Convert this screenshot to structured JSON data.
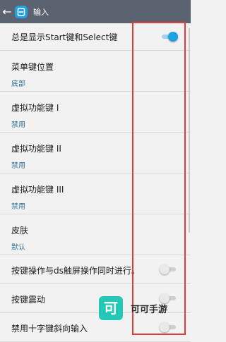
{
  "appbar": {
    "title": "输入"
  },
  "settings": [
    {
      "label": "总是显示Start键和Select键",
      "toggle": true
    },
    {
      "label": "菜单键位置",
      "value": "底部"
    },
    {
      "label": "虚拟功能键 I",
      "value": "禁用"
    },
    {
      "label": "虚拟功能键 II",
      "value": "禁用"
    },
    {
      "label": "虚拟功能键 III",
      "value": "禁用"
    },
    {
      "label": "皮肤",
      "value": "默认"
    },
    {
      "label": "按键操作与ds触屏操作同时进行。",
      "toggle": false
    },
    {
      "label": "按键震动",
      "toggle": false
    },
    {
      "label": "禁用十字键斜向输入",
      "toggle": false
    }
  ],
  "watermark": {
    "logo_char": "可",
    "text": "可可手游"
  },
  "colors": {
    "appbar": "#5b6270",
    "accent": "#1da1e2",
    "value_text": "#2f6f97",
    "highlight_box": "#e23b3b",
    "watermark": "#25c7b6"
  }
}
